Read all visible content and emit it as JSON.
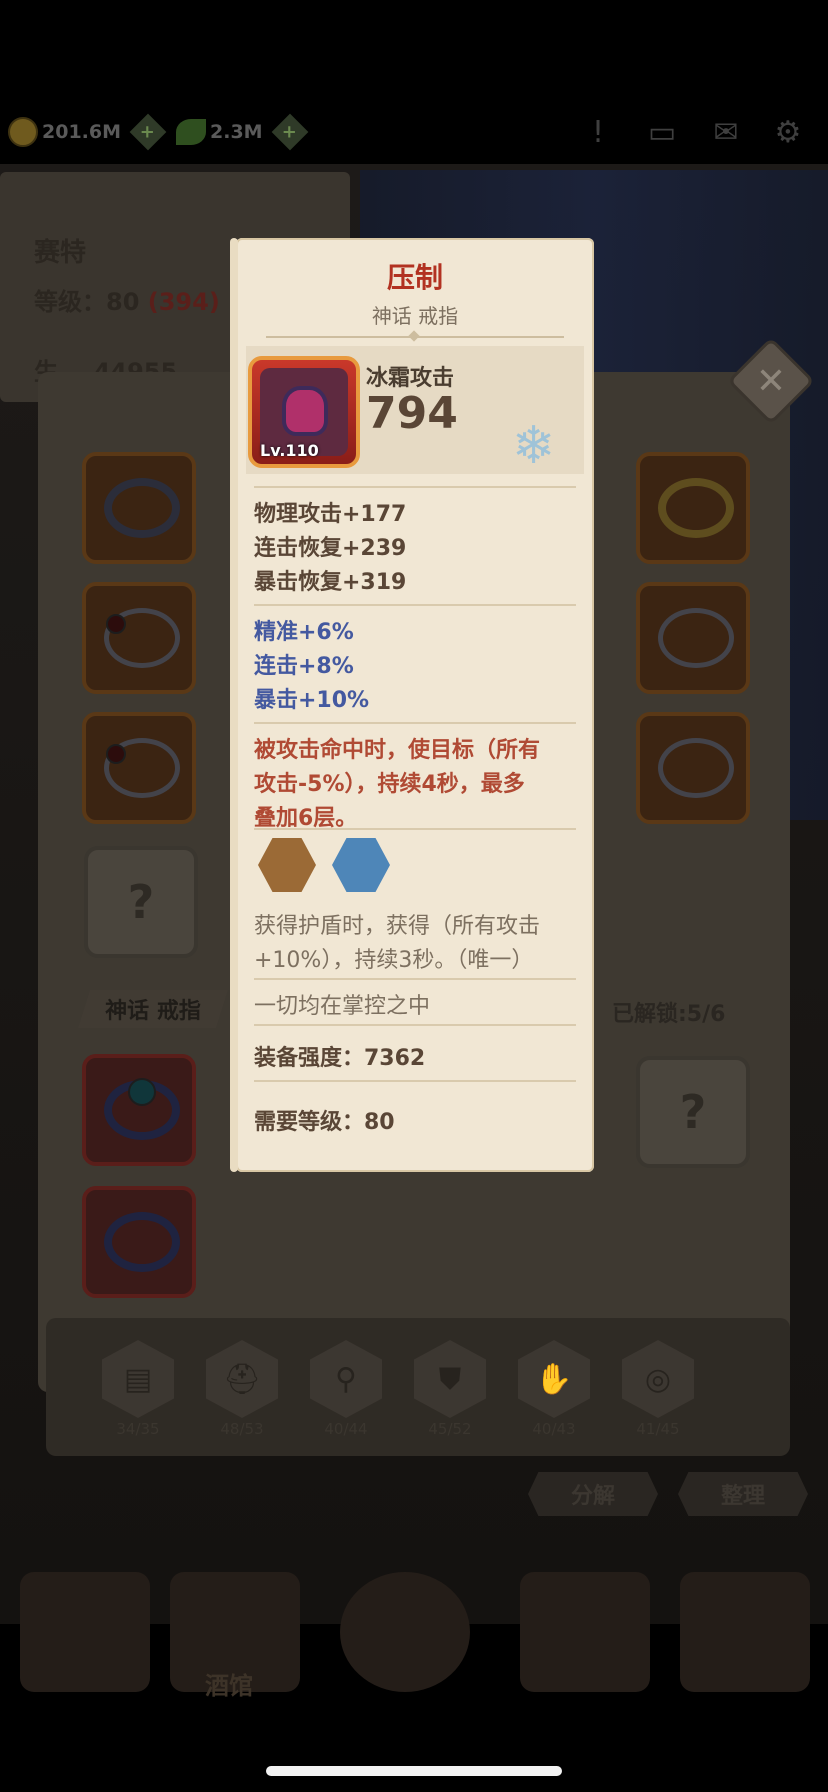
{
  "resources": {
    "gold": "201.6M",
    "gems": "2.3M"
  },
  "hero": {
    "name": "赛特",
    "level_label": "等级：80",
    "level_extra": "(394)",
    "stat_partial": "生... 44955"
  },
  "grid": {
    "section_title": "神话 戒指",
    "unlocked": "已解锁:5/6",
    "empty_symbol": "?"
  },
  "category_tabs": [
    {
      "icon": "book-icon",
      "count": "34/35"
    },
    {
      "icon": "helmet-icon",
      "count": "48/53"
    },
    {
      "icon": "staff-icon",
      "count": "40/44"
    },
    {
      "icon": "armor-icon",
      "count": "45/52"
    },
    {
      "icon": "glove-icon",
      "count": "40/43"
    },
    {
      "icon": "ring-icon",
      "count": "41/45"
    }
  ],
  "actions": {
    "decompose": "分解",
    "sort": "整理"
  },
  "nav": {
    "tavern": "酒馆"
  },
  "tooltip": {
    "title": "压制",
    "subtitle": "神话 戒指",
    "level_badge": "Lv.110",
    "main_stat_label": "冰霜攻击",
    "main_stat_value": "794",
    "stats": [
      "物理攻击+177",
      "连击恢复+239",
      "暴击恢复+319"
    ],
    "bonus_stats": [
      "精准+6%",
      "连击+8%",
      "暴击+10%"
    ],
    "effect_lines": [
      "被攻击命中时，使目标（所有",
      "攻击-5%），持续4秒，最多",
      "叠加6层。"
    ],
    "set_lines": [
      "获得护盾时，获得（所有攻击",
      "+10%），持续3秒。（唯一）"
    ],
    "flavor": "一切均在掌控之中",
    "power": "装备强度：7362",
    "required_level": "需要等级：80"
  },
  "colors": {
    "title_red": "#b23221",
    "bonus_blue": "#4459a0",
    "effect_red": "#b04a34",
    "parchment": "#f1e7d4"
  }
}
